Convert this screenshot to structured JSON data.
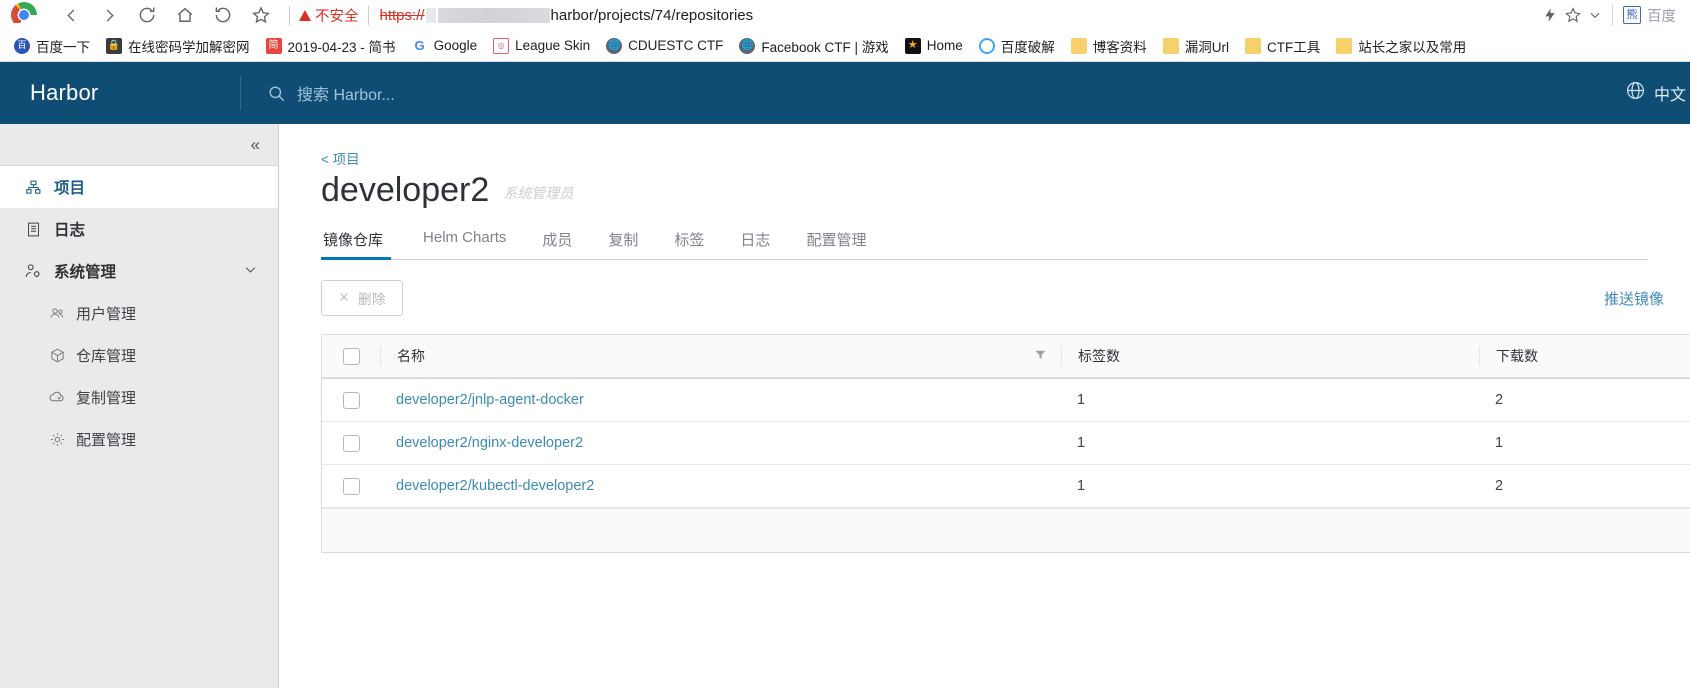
{
  "browser": {
    "security_label": "不安全",
    "url_scheme": "https://",
    "url_tail": "harbor/projects/74/repositories",
    "extension_label": "百度",
    "bookmarks": [
      {
        "label": "百度一下",
        "icon": "baidu-icon"
      },
      {
        "label": "在线密码学加解密网",
        "icon": "lock-icon"
      },
      {
        "label": "2019-04-23 - 简书",
        "icon": "jianshu-icon"
      },
      {
        "label": "Google",
        "icon": "google-icon"
      },
      {
        "label": "League Skin",
        "icon": "league-icon"
      },
      {
        "label": "CDUESTC CTF",
        "icon": "globe-icon"
      },
      {
        "label": "Facebook CTF | 游戏",
        "icon": "globe-icon"
      },
      {
        "label": "Home",
        "icon": "star-icon"
      },
      {
        "label": "百度破解",
        "icon": "ring-icon"
      },
      {
        "label": "博客资料",
        "icon": "folder-icon"
      },
      {
        "label": "漏洞Url",
        "icon": "folder-icon"
      },
      {
        "label": "CTF工具",
        "icon": "folder-icon"
      },
      {
        "label": "站长之家以及常用",
        "icon": "folder-icon"
      }
    ]
  },
  "header": {
    "brand": "Harbor",
    "search_placeholder": "搜索 Harbor...",
    "language": "中文"
  },
  "sidebar": {
    "items": [
      {
        "label": "项目",
        "icon": "projects-icon",
        "active": true
      },
      {
        "label": "日志",
        "icon": "log-icon",
        "active": false
      },
      {
        "label": "系统管理",
        "icon": "admin-icon",
        "active": false,
        "expanded": true
      }
    ],
    "sub_items": [
      {
        "label": "用户管理",
        "icon": "users-icon"
      },
      {
        "label": "仓库管理",
        "icon": "registry-icon"
      },
      {
        "label": "复制管理",
        "icon": "replication-icon"
      },
      {
        "label": "配置管理",
        "icon": "config-icon"
      }
    ]
  },
  "main": {
    "breadcrumb": "< 项目",
    "title": "developer2",
    "role": "系统管理员",
    "tabs": [
      {
        "label": "镜像仓库",
        "active": true
      },
      {
        "label": "Helm Charts",
        "active": false
      },
      {
        "label": "成员",
        "active": false
      },
      {
        "label": "复制",
        "active": false
      },
      {
        "label": "标签",
        "active": false
      },
      {
        "label": "日志",
        "active": false
      },
      {
        "label": "配置管理",
        "active": false
      }
    ],
    "delete_label": "删除",
    "push_image_label": "推送镜像",
    "table": {
      "columns": [
        "名称",
        "标签数",
        "下载数"
      ],
      "rows": [
        {
          "name": "developer2/jnlp-agent-docker",
          "tags": "1",
          "downloads": "2"
        },
        {
          "name": "developer2/nginx-developer2",
          "tags": "1",
          "downloads": "1"
        },
        {
          "name": "developer2/kubectl-developer2",
          "tags": "1",
          "downloads": "2"
        }
      ]
    }
  },
  "colors": {
    "header_bg": "#0f4d74",
    "link": "#3d8ab5",
    "accent": "#0079b8",
    "sidebar_bg": "#eaeaec"
  }
}
